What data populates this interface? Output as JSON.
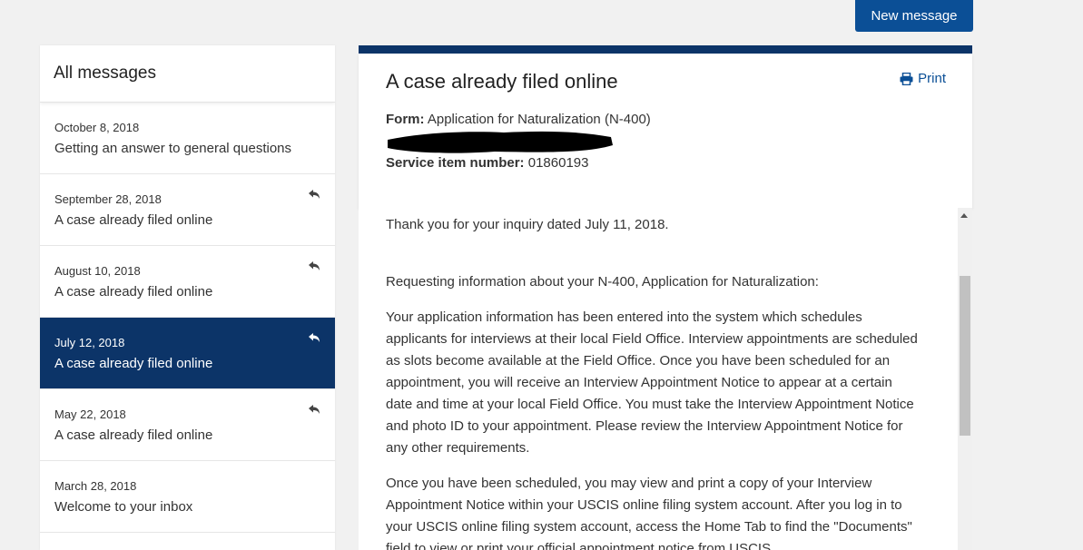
{
  "toolbar": {
    "new_message_label": "New message"
  },
  "sidebar": {
    "title": "All messages",
    "items": [
      {
        "date": "October 8, 2018",
        "subject": "Getting an answer to general questions",
        "replied": false,
        "active": false
      },
      {
        "date": "September 28, 2018",
        "subject": "A case already filed online",
        "replied": true,
        "active": false
      },
      {
        "date": "August 10, 2018",
        "subject": "A case already filed online",
        "replied": true,
        "active": false
      },
      {
        "date": "July 12, 2018",
        "subject": "A case already filed online",
        "replied": true,
        "active": true
      },
      {
        "date": "May 22, 2018",
        "subject": "A case already filed online",
        "replied": true,
        "active": false
      },
      {
        "date": "March 28, 2018",
        "subject": "Welcome to your inbox",
        "replied": false,
        "active": false
      }
    ]
  },
  "message": {
    "title": "A case already filed online",
    "print_label": "Print",
    "form_label": "Form:",
    "form_value": "Application for Naturalization (N-400)",
    "service_label": "Service item number:",
    "service_value": "01860193",
    "body": [
      "Thank you for your inquiry dated July 11, 2018.",
      "Requesting information about your N-400, Application for Naturalization:",
      "Your application information has been entered into the system which schedules applicants for interviews at their local Field Office. Interview appointments are scheduled as slots become available at the Field Office. Once you have been scheduled for an appointment, you will receive an Interview Appointment Notice to appear at a certain date and time at your local Field Office. You must take the Interview Appointment Notice and photo ID to your appointment. Please review the Interview Appointment Notice for any other requirements.",
      "Once you have been scheduled, you may view and print a copy of your Interview Appointment Notice within your USCIS online filing system account. After you log in to your USCIS online filing system account, access the Home Tab to find the \"Documents\" field to view or print your official appointment notice from USCIS."
    ]
  },
  "colors": {
    "accent": "#0b4f96",
    "active_bg": "#0c3468",
    "page_bg": "#f1f1f1"
  },
  "icons": {
    "reply": "reply-icon",
    "print": "printer-icon"
  }
}
